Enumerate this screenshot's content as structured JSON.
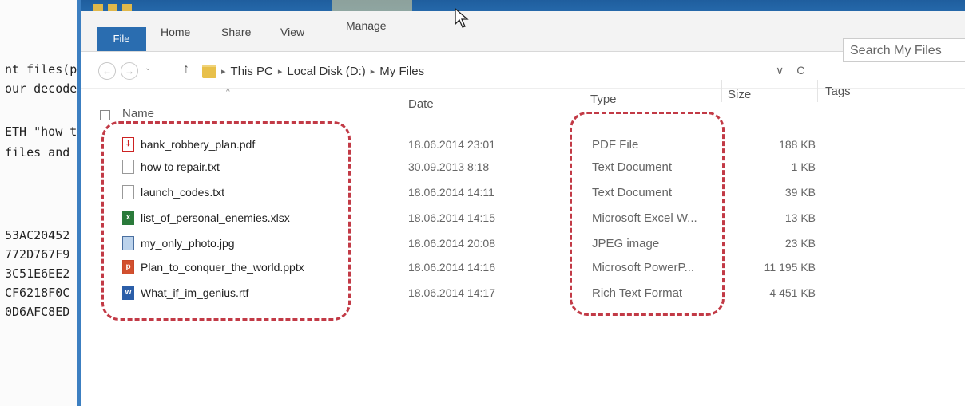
{
  "terminal": {
    "lines": [
      "nt files(p",
      "our decode",
      "ETH \"how t",
      " files and",
      "53AC20452",
      "772D767F9",
      "3C51E6EE2",
      "CF6218F0C",
      "0D6AFC8ED"
    ]
  },
  "ribbon": {
    "tabs": {
      "file": "File",
      "home": "Home",
      "share": "Share",
      "view": "View",
      "manage": "Manage"
    }
  },
  "address": {
    "back_icon": "back-arrow-icon",
    "forward_icon": "forward-arrow-icon",
    "up_icon": "up-arrow-icon",
    "path": [
      "This PC",
      "Local Disk (D:)",
      "My Files"
    ],
    "dropdown_glyph": "∨",
    "refresh_glyph": "C"
  },
  "search": {
    "placeholder": "Search My Files"
  },
  "columns": {
    "name": "Name",
    "date": "Date",
    "type": "Type",
    "size": "Size",
    "tags": "Tags"
  },
  "files": [
    {
      "name": "bank_robbery_plan.pdf",
      "date": "18.06.2014 23:01",
      "type": "PDF File",
      "size": "188 KB",
      "icon": "pdf-icon"
    },
    {
      "name": "how to repair.txt",
      "date": "30.09.2013 8:18",
      "type": "Text Document",
      "size": "1 KB",
      "icon": "text-file-icon"
    },
    {
      "name": "launch_codes.txt",
      "date": "18.06.2014 14:11",
      "type": "Text Document",
      "size": "39 KB",
      "icon": "text-file-icon"
    },
    {
      "name": "list_of_personal_enemies.xlsx",
      "date": "18.06.2014 14:15",
      "type": "Microsoft Excel W...",
      "size": "13 KB",
      "icon": "excel-file-icon"
    },
    {
      "name": "my_only_photo.jpg",
      "date": "18.06.2014 20:08",
      "type": "JPEG image",
      "size": "23 KB",
      "icon": "image-file-icon"
    },
    {
      "name": "Plan_to_conquer_the_world.pptx",
      "date": "18.06.2014 14:16",
      "type": "Microsoft PowerP...",
      "size": "11 195 KB",
      "icon": "powerpoint-file-icon"
    },
    {
      "name": "What_if_im_genius.rtf",
      "date": "18.06.2014 14:17",
      "type": "Rich Text Format",
      "size": "4 451 KB",
      "icon": "rtf-file-icon"
    }
  ],
  "colors": {
    "highlight": "#c23a46",
    "file_tab": "#2a6db0",
    "window_border": "#3c7fc1"
  }
}
